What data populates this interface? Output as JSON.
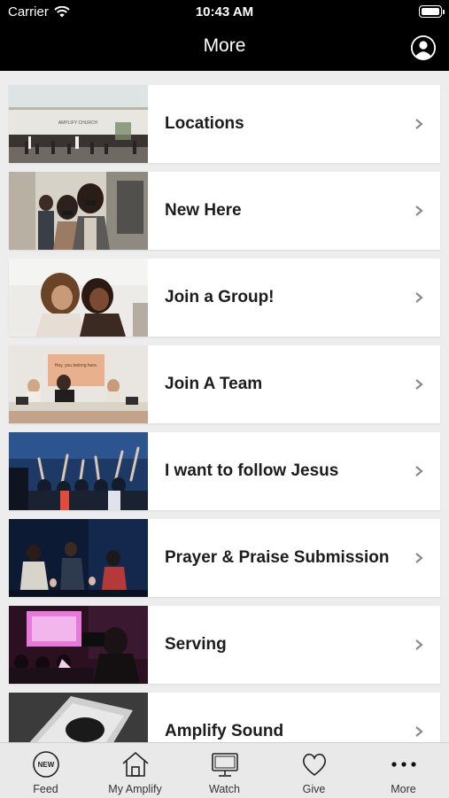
{
  "status_bar": {
    "carrier": "Carrier",
    "time": "10:43 AM"
  },
  "header": {
    "title": "More"
  },
  "menu": [
    {
      "label": "Locations",
      "image": "church-building-photo"
    },
    {
      "label": "New Here",
      "image": "people-masks-photo"
    },
    {
      "label": "Join a Group!",
      "image": "two-friends-photo"
    },
    {
      "label": "Join A Team",
      "image": "welcome-desk-photo"
    },
    {
      "label": "I want to follow Jesus",
      "image": "worship-crowd-photo"
    },
    {
      "label": "Prayer & Praise Submission",
      "image": "stage-worship-photo"
    },
    {
      "label": "Serving",
      "image": "camera-operator-photo"
    },
    {
      "label": "Amplify Sound",
      "image": "sound-booth-photo"
    }
  ],
  "tabs": [
    {
      "label": "Feed",
      "icon": "new-badge-icon"
    },
    {
      "label": "My Amplify",
      "icon": "house-icon"
    },
    {
      "label": "Watch",
      "icon": "monitor-icon"
    },
    {
      "label": "Give",
      "icon": "heart-icon"
    },
    {
      "label": "More",
      "icon": "more-dots-icon"
    }
  ],
  "building_sign": "AMPLIFY CHURCH",
  "desk_sign": "Hey, you belong here."
}
